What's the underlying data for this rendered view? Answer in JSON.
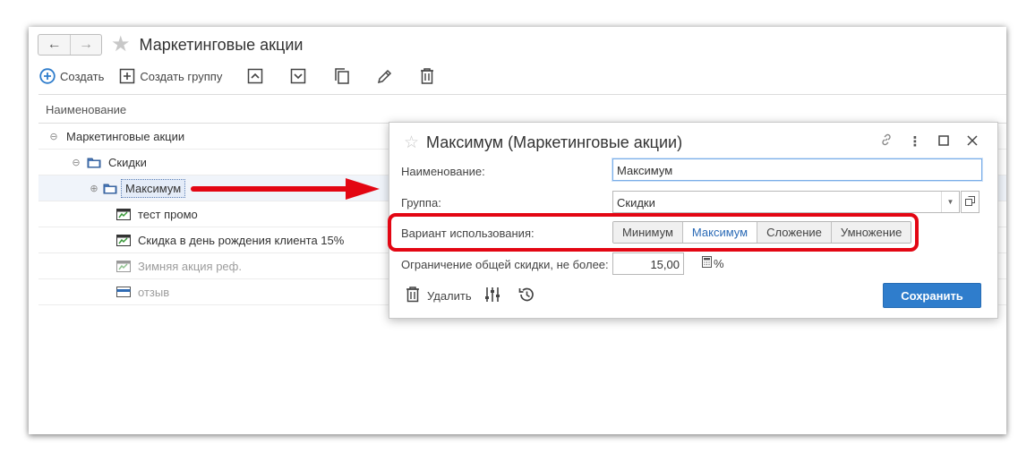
{
  "main": {
    "title": "Маркетинговые акции",
    "toolbar": {
      "create_label": "Создать",
      "create_group_label": "Создать группу"
    },
    "grid": {
      "column_header": "Наименование",
      "rows": [
        {
          "label": "Маркетинговые акции"
        },
        {
          "label": "Скидки"
        },
        {
          "label": "Максимум"
        },
        {
          "label": "тест промо"
        },
        {
          "label": "Скидка в день рождения клиента 15%"
        },
        {
          "label": "Зимняя акция реф."
        },
        {
          "label": "отзыв"
        }
      ]
    }
  },
  "dialog": {
    "title": "Максимум (Маркетинговые акции)",
    "fields": {
      "name_label": "Наименование:",
      "name_value": "Максимум",
      "group_label": "Группа:",
      "group_value": "Скидки",
      "usage_label": "Вариант использования:",
      "usage_options": [
        "Минимум",
        "Максимум",
        "Сложение",
        "Умножение"
      ],
      "usage_selected": "Максимум",
      "limit_label": "Ограничение общей скидки, не более:",
      "limit_value": "15,00",
      "limit_unit": "%"
    },
    "footer": {
      "delete_label": "Удалить",
      "save_label": "Сохранить"
    }
  },
  "colors": {
    "accent": "#2f7dcc",
    "highlight": "#e30613",
    "selected_text": "#2a6ab6"
  }
}
